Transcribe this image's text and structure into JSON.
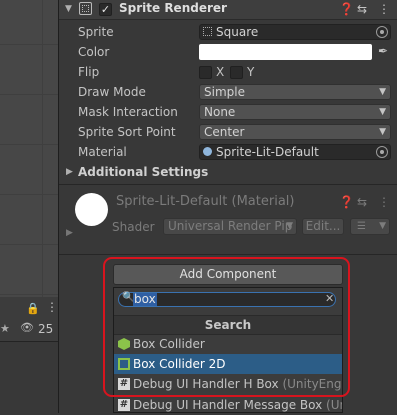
{
  "component": {
    "title": "Sprite Renderer",
    "enabled": true,
    "fields": {
      "sprite": {
        "label": "Sprite",
        "value": "Square"
      },
      "color": {
        "label": "Color",
        "value": "#ffffff"
      },
      "flip": {
        "label": "Flip",
        "x": "X",
        "y": "Y"
      },
      "draw_mode": {
        "label": "Draw Mode",
        "value": "Simple"
      },
      "mask_interaction": {
        "label": "Mask Interaction",
        "value": "None"
      },
      "sprite_sort_point": {
        "label": "Sprite Sort Point",
        "value": "Center"
      },
      "material": {
        "label": "Material",
        "value": "Sprite-Lit-Default"
      }
    },
    "additional_settings": "Additional Settings"
  },
  "material_panel": {
    "title": "Sprite-Lit-Default (Material)",
    "shader_label": "Shader",
    "shader_value": "Universal Render Pip",
    "edit_button": "Edit..."
  },
  "hierarchy": {
    "visible_count": "25"
  },
  "add_component": {
    "button_label": "Add Component",
    "search_value": "box",
    "section_title": "Search",
    "results": [
      {
        "label": "Box Collider",
        "icon": "cube-icon",
        "selected": false
      },
      {
        "label": "Box Collider 2D",
        "icon": "box-collider-2d-icon",
        "selected": true
      },
      {
        "label": "Debug UI Handler H Box",
        "suffix": "(UnityEngine",
        "icon": "script-icon",
        "selected": false
      },
      {
        "label": "Debug UI Handler Message Box",
        "suffix": "(Unity",
        "icon": "script-icon",
        "selected": false
      }
    ]
  },
  "colors": {
    "highlight": "#d8141e",
    "selection": "#2c5d87",
    "search_border": "#3a72b0"
  }
}
